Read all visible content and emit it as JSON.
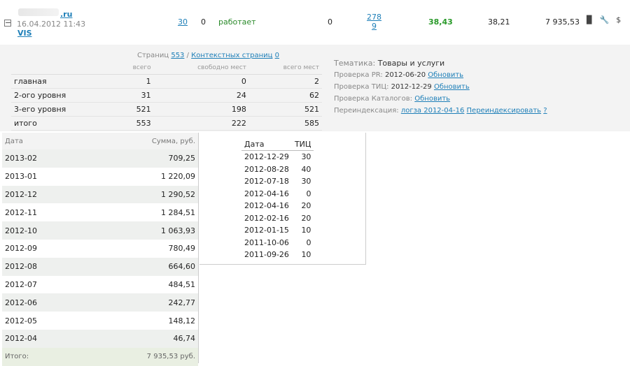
{
  "site": {
    "domain": ".ru",
    "date": "16.04.2012 11:43",
    "tag": "VIS"
  },
  "row": {
    "links": "30",
    "zero1": "0",
    "status": "работает",
    "zero2": "0",
    "frac_top": "278",
    "frac_bottom": "9",
    "green_value": "38,43",
    "value_b": "38,21",
    "sum": "7 935,53"
  },
  "icons": [
    "bar-chart-icon",
    "wrench-icon",
    "dollar-icon"
  ],
  "pages": {
    "label": "Страниц",
    "count": "553",
    "ctx_label": "Контекстных страниц",
    "ctx_count": "0"
  },
  "pages_table": {
    "headers": [
      "",
      "всего",
      "свободно мест",
      "всего мест"
    ],
    "rows": [
      [
        "главная",
        "1",
        "0",
        "2"
      ],
      [
        "2-ого уровня",
        "31",
        "24",
        "62"
      ],
      [
        "3-его уровня",
        "521",
        "198",
        "521"
      ],
      [
        "итого",
        "553",
        "222",
        "585"
      ]
    ]
  },
  "info": {
    "topic_label": "Тематика:",
    "topic_value": "Товары и услуги",
    "pr_label": "Проверка PR:",
    "pr_date": "2012-06-20",
    "pr_link": "Обновить",
    "tic_label": "Проверка ТИЦ:",
    "tic_date": "2012-12-29",
    "tic_link": "Обновить",
    "cat_label": "Проверка Каталогов:",
    "cat_link": "Обновить",
    "reindex_label": "Переиндексация:",
    "reindex_log": "логза 2012-04-16",
    "reindex_link": "Переиндексировать",
    "reindex_help": "?"
  },
  "payments": {
    "headers": [
      "Дата",
      "Сумма, руб."
    ],
    "rows": [
      [
        "2013-02",
        "709,25"
      ],
      [
        "2013-01",
        "1 220,09"
      ],
      [
        "2012-12",
        "1 290,52"
      ],
      [
        "2012-11",
        "1 284,51"
      ],
      [
        "2012-10",
        "1 063,93"
      ],
      [
        "2012-09",
        "780,49"
      ],
      [
        "2012-08",
        "664,60"
      ],
      [
        "2012-07",
        "484,51"
      ],
      [
        "2012-06",
        "242,77"
      ],
      [
        "2012-05",
        "148,12"
      ],
      [
        "2012-04",
        "46,74"
      ]
    ],
    "total_label": "Итого:",
    "total_value": "7 935,53 руб."
  },
  "tic_history": {
    "headers": [
      "Дата",
      "ТИЦ"
    ],
    "rows": [
      [
        "2012-12-29",
        "30"
      ],
      [
        "2012-08-28",
        "40"
      ],
      [
        "2012-07-18",
        "30"
      ],
      [
        "2012-04-16",
        "0"
      ],
      [
        "2012-04-16",
        "20"
      ],
      [
        "2012-02-16",
        "20"
      ],
      [
        "2012-01-15",
        "10"
      ],
      [
        "2011-10-06",
        "0"
      ],
      [
        "2011-09-26",
        "10"
      ]
    ]
  }
}
